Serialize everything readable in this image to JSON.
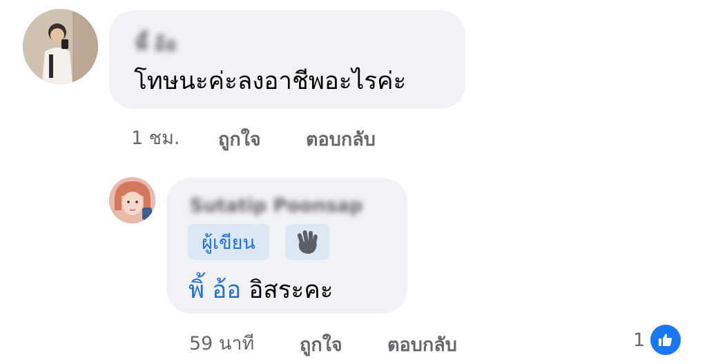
{
  "comment": {
    "author": "พี้ อ้อ",
    "text": "โทษนะค่ะลงอาชีพอะไรค่ะ",
    "time": "1 ชม.",
    "like_label": "ถูกใจ",
    "reply_label": "ตอบกลับ"
  },
  "reply": {
    "author": "Sutatip Poonsap",
    "author_badge": "ผู้เขียน",
    "mention": "พิ้ อ้อ",
    "text": " อิสระคะ",
    "time": "59 นาที",
    "like_label": "ถูกใจ",
    "reply_label": "ตอบกลับ",
    "reaction_count": "1"
  },
  "colors": {
    "bubble": "#f0f2f5",
    "link": "#216fdb",
    "meta": "#65676b",
    "like_icon": "#1877f2"
  },
  "icons": {
    "badge_icon": "waving-hand-icon",
    "reaction_icon": "thumbs-up-icon"
  }
}
